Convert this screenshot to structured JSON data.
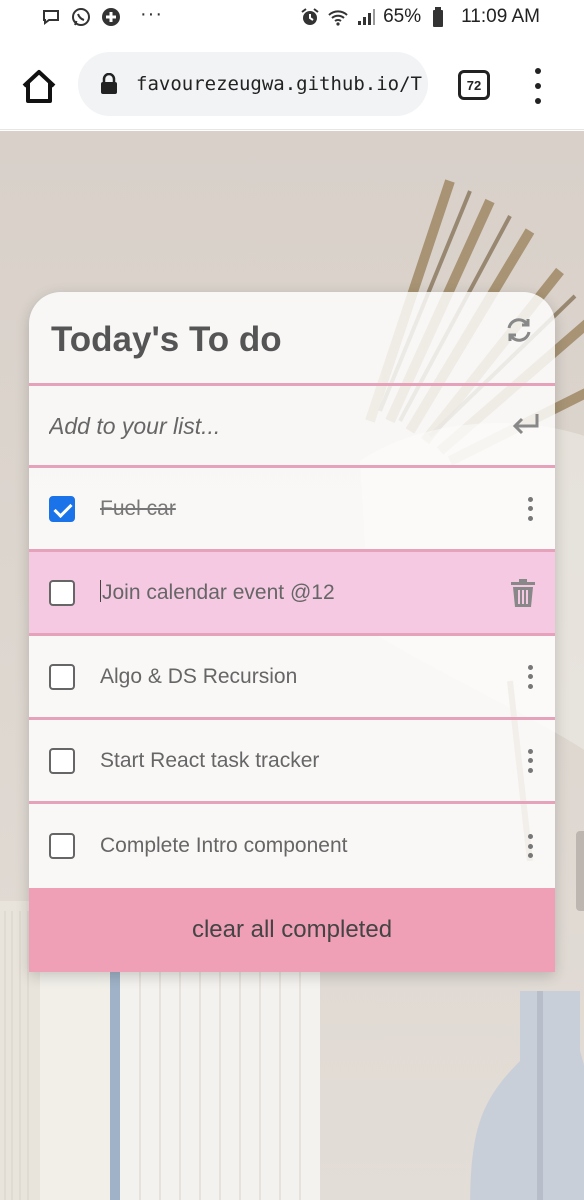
{
  "status_bar": {
    "battery": "65%",
    "time": "11:09 AM",
    "icons": [
      "chat-bubble-icon",
      "whatsapp-icon",
      "plus-cross-icon",
      "more-dots-icon",
      "alarm-icon",
      "wifi-icon",
      "signal-icon",
      "battery-icon"
    ]
  },
  "browser": {
    "url": "favourezeugwa.github.io/T",
    "tab_count": "72"
  },
  "app": {
    "title": "Today's To do",
    "input_placeholder": "Add to your list...",
    "todos": [
      {
        "text": "Fuel car",
        "completed": true,
        "highlighted": false,
        "action": "menu"
      },
      {
        "text": "Join calendar event @12",
        "completed": false,
        "highlighted": true,
        "action": "delete"
      },
      {
        "text": "Algo & DS Recursion",
        "completed": false,
        "highlighted": false,
        "action": "menu"
      },
      {
        "text": "Start React task tracker",
        "completed": false,
        "highlighted": false,
        "action": "menu"
      },
      {
        "text": "Complete Intro component",
        "completed": false,
        "highlighted": false,
        "action": "menu"
      }
    ],
    "clear_label": "clear all completed"
  },
  "colors": {
    "accent_pink": "#efa0b6",
    "divider_pink": "#e7a2bb",
    "highlight_row": "#f6c9e3",
    "checkbox_blue": "#1a73e8"
  }
}
